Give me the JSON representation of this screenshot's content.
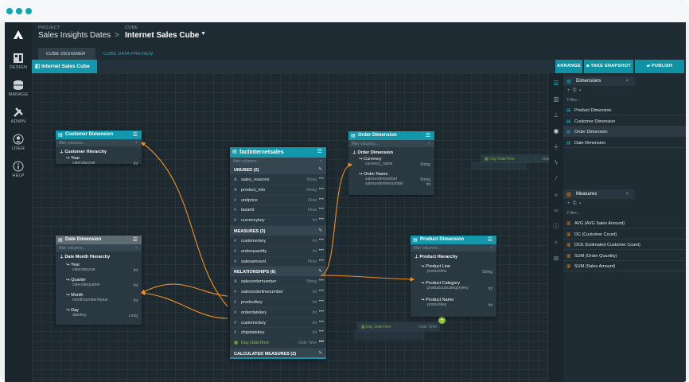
{
  "header": {
    "project_caption": "PROJECT",
    "project_name": "Sales Insights Dates",
    "separator": ">",
    "cube_caption": "CUBE",
    "cube_name": "Internet Sales Cube",
    "tabs": [
      "CUBE DESIGNER",
      "CUBE DATA PREVIEW"
    ]
  },
  "nav": [
    "DESIGN",
    "MANAGE",
    "ADMIN",
    "USER",
    "HELP"
  ],
  "toolbar": {
    "cube_tab": "Internet Sales Cube",
    "arrange": "ARRANGE",
    "snapshot": "TAKE SNAPSHOT",
    "publish": "PUBLISH"
  },
  "customer_dim": {
    "title": "Customer Dimension",
    "filter": "filter columns...",
    "hierarchy": "Customer Hierarchy",
    "levels": [
      {
        "name": "Year",
        "col": "calendaryear",
        "type": "Int"
      }
    ]
  },
  "date_dim": {
    "title": "Date Dimension",
    "filter": "filter columns...",
    "hierarchy": "Date Month Hierarchy",
    "levels": [
      {
        "name": "Year",
        "col": "calendaryear",
        "type": "Int"
      },
      {
        "name": "Quarter",
        "col": "calendarquarter",
        "type": "Int"
      },
      {
        "name": "Month",
        "col": "monthnumberofyear",
        "type": "Int"
      },
      {
        "name": "Day",
        "col": "datekey",
        "type": "Long"
      }
    ]
  },
  "order_dim": {
    "title": "Order Dimension",
    "filter": "filter columns...",
    "hierarchy": "Order Dimension",
    "levels": [
      {
        "name": "Currency",
        "col": "currency_name",
        "type": "String"
      },
      {
        "name": "Order Name",
        "col": "salesordernumber",
        "col2": "salesorderlinenumber",
        "type": "String",
        "type2": "Int"
      }
    ]
  },
  "product_dim": {
    "title": "Product Dimension",
    "filter": "filter columns...",
    "hierarchy": "Product Hierarchy",
    "levels": [
      {
        "name": "Product Line",
        "col": "productline",
        "type": "String"
      },
      {
        "name": "Product Category",
        "col": "productsubcategorykey",
        "type": "Int"
      },
      {
        "name": "Product Name",
        "col": "productkey",
        "type": "Int"
      }
    ]
  },
  "fact": {
    "title": "factinternetsales",
    "filter": "filter columns...",
    "sections": [
      {
        "label": "UNUSED (2)",
        "rows": [
          {
            "g": "A",
            "name": "sales_reasons",
            "type": "String"
          },
          {
            "g": "A",
            "name": "product_info",
            "type": "String"
          },
          {
            "g": "#",
            "name": "unitprice",
            "type": "Float"
          },
          {
            "g": "#",
            "name": "taxamt",
            "type": "Float"
          },
          {
            "g": "#",
            "name": "currencykey",
            "type": "Int"
          }
        ]
      },
      {
        "label": "MEASURES (3)",
        "rows": [
          {
            "g": "#",
            "name": "customerkey",
            "type": "Int"
          },
          {
            "g": "#",
            "name": "orderquantity",
            "type": "Int"
          },
          {
            "g": "#",
            "name": "salesamount",
            "type": "Float"
          }
        ]
      },
      {
        "label": "RELATIONSHIPS (6)",
        "rows": [
          {
            "g": "A",
            "name": "salesordernumber",
            "type": "String"
          },
          {
            "g": "#",
            "name": "salesorderlinenumber",
            "type": "Int"
          },
          {
            "g": "#",
            "name": "productkey",
            "type": "Int"
          },
          {
            "g": "#",
            "name": "orderdatekey",
            "type": "Int"
          },
          {
            "g": "#",
            "name": "customerkey",
            "type": "Int"
          },
          {
            "g": "#",
            "name": "shipdatekey",
            "type": "Int"
          }
        ]
      }
    ],
    "day_row": {
      "name": "Day DateTime",
      "type": "Date Time"
    },
    "calc": "CALCULATED MEASURES (2)"
  },
  "ghosts": {
    "top": {
      "name": "Day DateTime",
      "type": "Date Time"
    },
    "bottom": {
      "name": "Day DateTime",
      "type": "Date Time"
    }
  },
  "dimensions_panel": {
    "title": "Dimensions",
    "filter": "Filter...",
    "items": [
      "Product Dimension",
      "Customer Dimension",
      "Order Dimension",
      "Date Dimension"
    ]
  },
  "measures_panel": {
    "title": "Measures",
    "filter": "Filter...",
    "items": [
      "AVG (AVG Sales Amount)",
      "DC (Customer Count)",
      "DCE (Estimated Customer Count)",
      "SUM (Order Quantity)",
      "SUM (Sales Amount)"
    ]
  },
  "colors": {
    "teal": "#1398ab",
    "orange": "#f0901e",
    "green": "#8cc63f",
    "gray_header": "#5f6b72"
  }
}
